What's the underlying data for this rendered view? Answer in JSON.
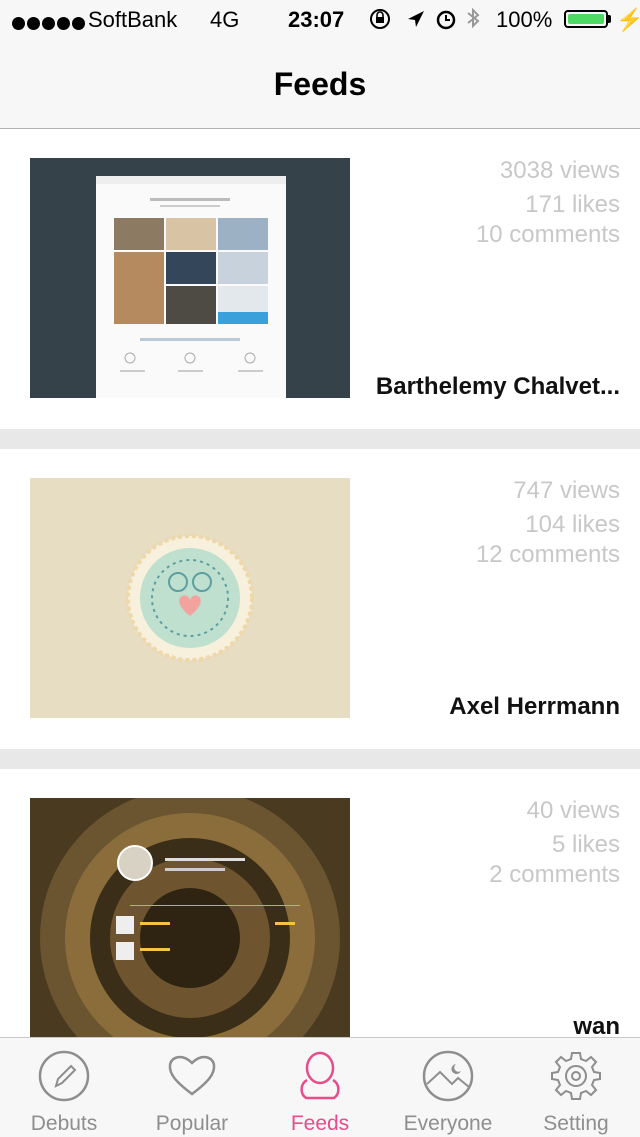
{
  "status_bar": {
    "carrier": "SoftBank",
    "network": "4G",
    "time": "23:07",
    "battery": "100%"
  },
  "nav": {
    "title": "Feeds"
  },
  "feeds": [
    {
      "views": "3038 views",
      "likes": "171 likes",
      "comments": "10 comments",
      "author": "Barthelemy Chalvet..."
    },
    {
      "views": "747 views",
      "likes": "104 likes",
      "comments": "12 comments",
      "author": "Axel Herrmann"
    },
    {
      "views": "40 views",
      "likes": "5 likes",
      "comments": "2 comments",
      "author": "wan"
    }
  ],
  "tabs": [
    {
      "label": "Debuts",
      "icon": "pencil-icon"
    },
    {
      "label": "Popular",
      "icon": "heart-icon"
    },
    {
      "label": "Feeds",
      "icon": "person-icon",
      "active": true
    },
    {
      "label": "Everyone",
      "icon": "landscape-icon"
    },
    {
      "label": "Setting",
      "icon": "gear-icon"
    }
  ],
  "colors": {
    "accent": "#ea4c89",
    "battery": "#4cd964",
    "stat_text": "#c8c8c8"
  }
}
